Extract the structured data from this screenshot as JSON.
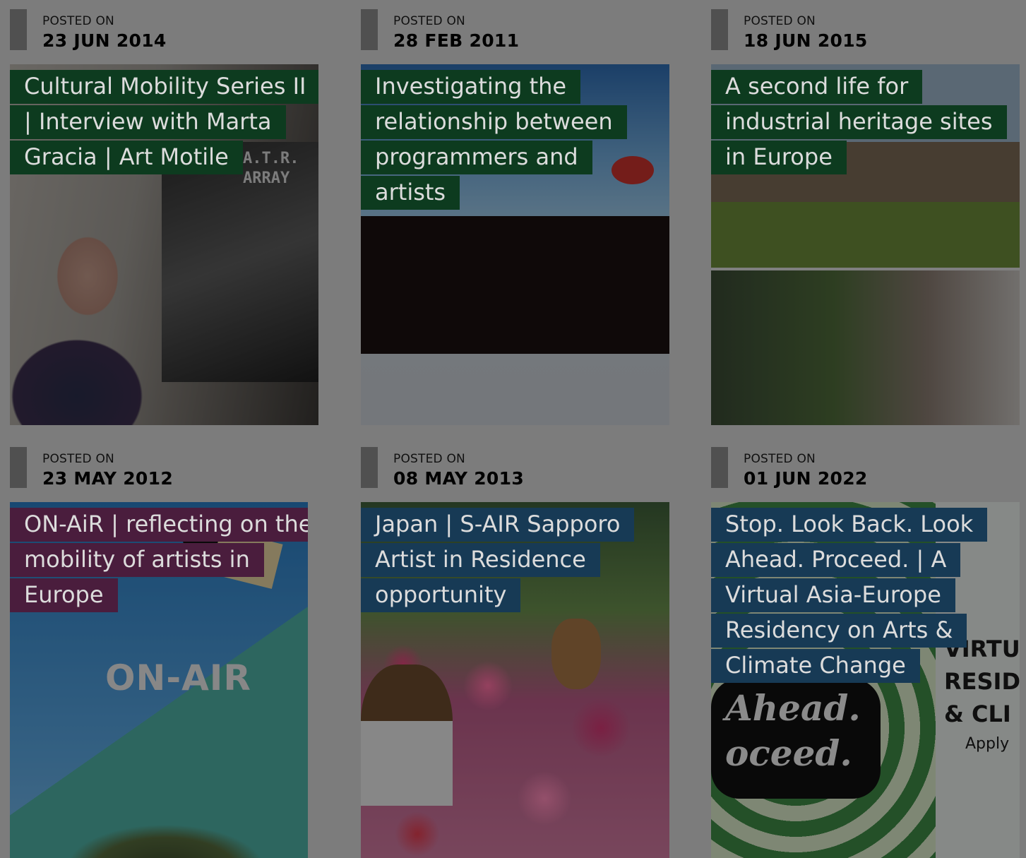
{
  "posted_on_label": "POSTED ON",
  "posts": [
    {
      "date": "23 JUN 2014",
      "title": "Cultural Mobility Series II | Interview with Marta Gracia | Art Motile",
      "tag_color": "#0d3b1f",
      "image_text": "A.T.R. ARRAY"
    },
    {
      "date": "28 FEB 2011",
      "title": "Investigating the relationship between programmers and artists",
      "tag_color": "#0d3b1f"
    },
    {
      "date": "18 JUN 2015",
      "title": "A second life for industrial heritage sites in Europe",
      "tag_color": "#0d3b1f"
    },
    {
      "date": "23 MAY 2012",
      "title": "ON-AiR | reflecting on the mobility of artists in Europe",
      "tag_color": "#4a1d3d",
      "image_text": "ON-AIR"
    },
    {
      "date": "08 MAY 2013",
      "title": "Japan | S-AIR Sapporo Artist in Residence opportunity",
      "tag_color": "#173a55"
    },
    {
      "date": "01 JUN 2022",
      "title": "Stop. Look Back. Look Ahead. Proceed. | A Virtual Asia-Europe Residency on Arts & Climate Change",
      "tag_color": "#173a55",
      "image_text": "Ahead. oceed.",
      "image_panel_text": "VIRTU RESID & CLI",
      "image_panel_sub": "Apply"
    }
  ]
}
